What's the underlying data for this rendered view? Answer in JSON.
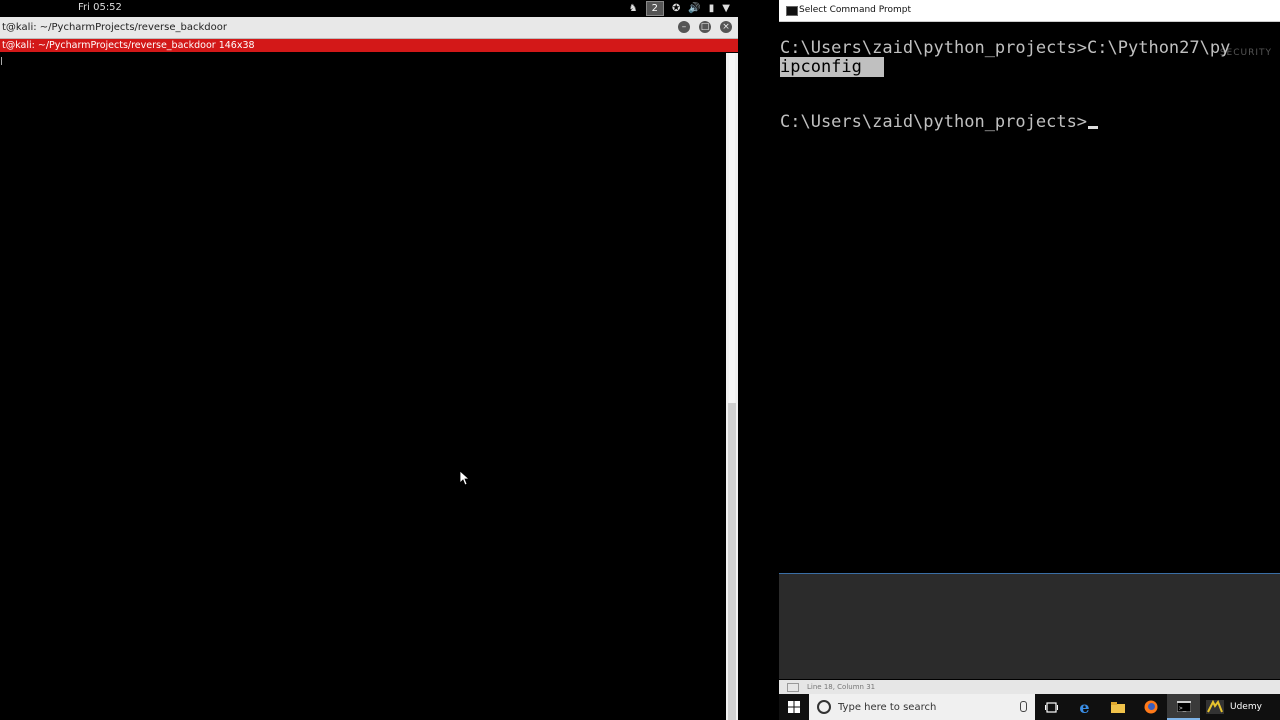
{
  "kali": {
    "topbar": {
      "clock": "Fri 05:52",
      "workspace": "2"
    },
    "window": {
      "title": "t@kali: ~/PycharmProjects/reverse_backdoor",
      "tab_title": "t@kali: ~/PycharmProjects/reverse_backdoor 146x38",
      "terminal_text": ""
    }
  },
  "cmd": {
    "title": "Select Command Prompt",
    "lines": [
      "C:\\Users\\zaid\\python_projects>C:\\Python27\\py",
      "ipconfig",
      "C:\\Users\\zaid\\python_projects>"
    ],
    "watermark": "SECURITY",
    "status_text": "Line 18, Column 31"
  },
  "taskbar": {
    "search_placeholder": "Type here to search",
    "udemy_label": "Udemy"
  },
  "icons": {
    "start": "windows-start-icon",
    "task_view": "task-view-icon",
    "edge": "edge-icon",
    "explorer": "file-explorer-icon",
    "firefox": "firefox-icon",
    "cmd": "command-prompt-icon",
    "udemy": "udemy-icon"
  },
  "colors": {
    "kali_tab_red": "#d31818",
    "cmd_selection": "#c0c0c0",
    "taskbar_bg": "#101010"
  }
}
